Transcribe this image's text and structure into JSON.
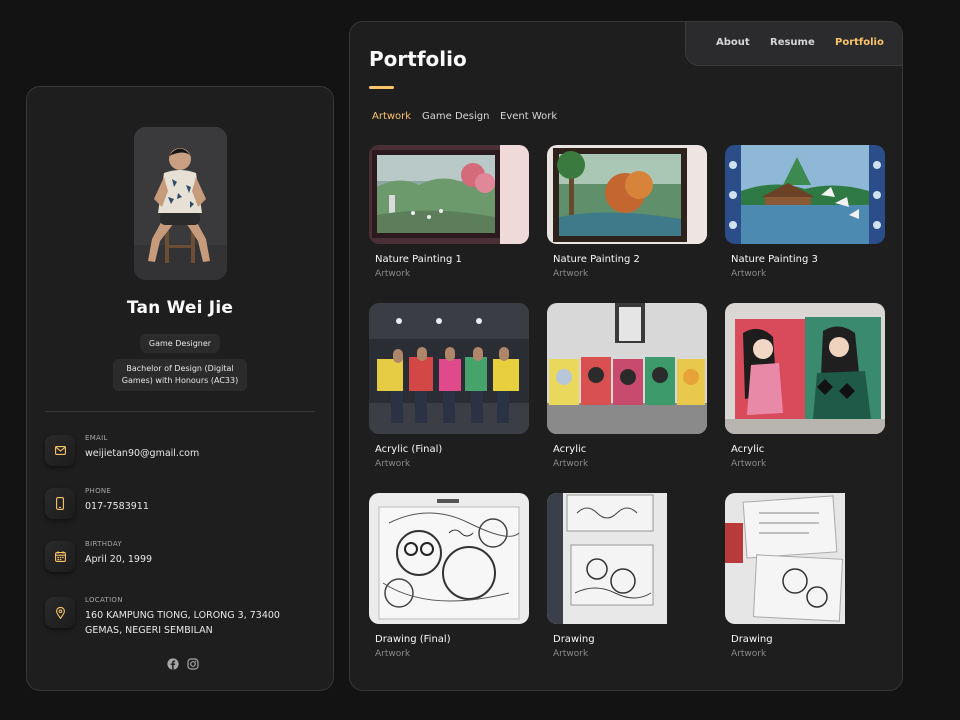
{
  "profile": {
    "name": "Tan Wei Jie",
    "title": "Game Designer",
    "degree": "Bachelor of Design (Digital Games) with Honours (AC33)"
  },
  "contacts": [
    {
      "label": "EMAIL",
      "value": "weijietan90@gmail.com",
      "icon": "mail-icon"
    },
    {
      "label": "PHONE",
      "value": "017-7583911",
      "icon": "phone-icon"
    },
    {
      "label": "BIRTHDAY",
      "value": "April 20, 1999",
      "icon": "calendar-icon"
    },
    {
      "label": "LOCATION",
      "value": "160 KAMPUNG TIONG, LORONG 3, 73400 GEMAS, NEGERI SEMBILAN",
      "icon": "location-pin-icon"
    }
  ],
  "social": [
    "facebook-icon",
    "instagram-icon"
  ],
  "navbar": {
    "items": [
      "About",
      "Resume",
      "Portfolio"
    ],
    "active": "Portfolio"
  },
  "page": {
    "title": "Portfolio"
  },
  "filters": {
    "items": [
      "Artwork",
      "Game Design",
      "Event Work"
    ],
    "active": "Artwork"
  },
  "projects": [
    {
      "title": "Nature Painting 1",
      "category": "Artwork"
    },
    {
      "title": "Nature Painting 2",
      "category": "Artwork"
    },
    {
      "title": "Nature Painting 3",
      "category": "Artwork"
    },
    {
      "title": "Acrylic (Final)",
      "category": "Artwork"
    },
    {
      "title": "Acrylic",
      "category": "Artwork"
    },
    {
      "title": "Acrylic",
      "category": "Artwork"
    },
    {
      "title": "Drawing (Final)",
      "category": "Artwork"
    },
    {
      "title": "Drawing",
      "category": "Artwork"
    },
    {
      "title": "Drawing",
      "category": "Artwork"
    }
  ],
  "colors": {
    "accent": "#fbc46a",
    "panel": "#1e1e1f",
    "background": "#131313"
  }
}
